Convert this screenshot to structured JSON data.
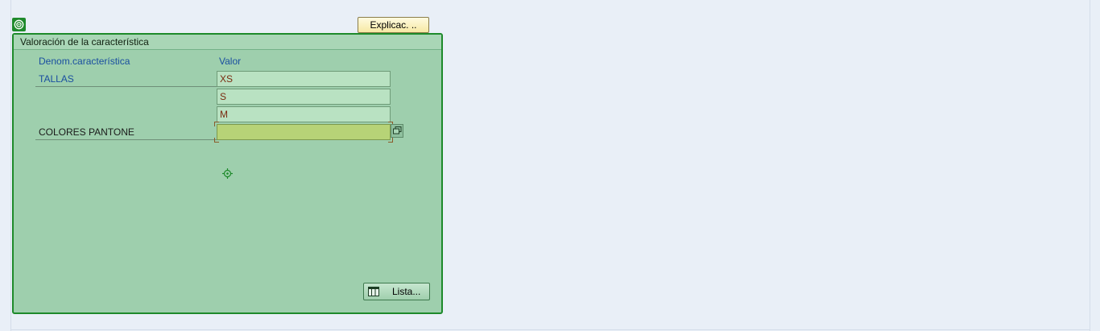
{
  "toolbar": {
    "explain_label": "Explicac. .."
  },
  "panel": {
    "title": "Valoración de la característica",
    "col_name_header": "Denom.característica",
    "col_value_header": "Valor",
    "characteristics": [
      {
        "name": "TALLAS",
        "values": [
          "XS",
          "S",
          "M"
        ]
      },
      {
        "name": "COLORES PANTONE",
        "values": [
          ""
        ]
      }
    ],
    "list_button_label": "Lista..."
  },
  "icons": {
    "corner": "target-ring-icon",
    "multi_value": "copy-windows-icon",
    "focus": "crosshair-icon",
    "list": "table-grid-icon"
  },
  "colors": {
    "panel_border": "#1d8a2a",
    "panel_bg": "#9ecfad",
    "label_blue": "#1a4fa0",
    "value_text": "#7a2b10",
    "active_field": "#b7d377"
  }
}
